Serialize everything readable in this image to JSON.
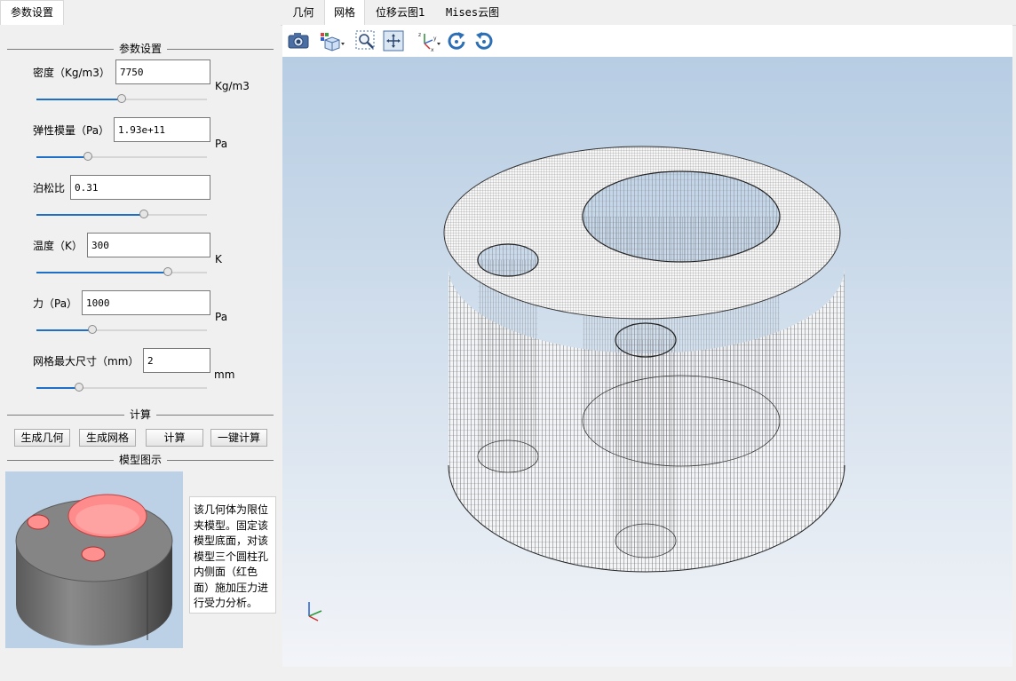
{
  "left_tabs": [
    {
      "label": "参数设置"
    }
  ],
  "right_tabs": [
    {
      "label": "几何"
    },
    {
      "label": "网格"
    },
    {
      "label": "位移云图1"
    },
    {
      "label": "Mises云图"
    }
  ],
  "param_group": {
    "title": "参数设置",
    "params": [
      {
        "label": "密度（Kg/m3）",
        "value": "7750",
        "unit": "Kg/m3",
        "slider": 0.5
      },
      {
        "label": "弹性模量（Pa）",
        "value": "1.93e+11",
        "unit": "Pa",
        "slider": 0.3
      },
      {
        "label": "泊松比",
        "value": "0.31",
        "unit": "",
        "slider": 0.63
      },
      {
        "label": "温度（K）",
        "value": "300",
        "unit": "K",
        "slider": 0.77
      },
      {
        "label": "力（Pa）",
        "value": "1000",
        "unit": "Pa",
        "slider": 0.33
      },
      {
        "label": "网格最大尺寸（mm）",
        "value": "2",
        "unit": "mm",
        "slider": 0.25
      }
    ]
  },
  "compute_group": {
    "title": "计算",
    "buttons": [
      {
        "label": "生成几何"
      },
      {
        "label": "生成网格"
      },
      {
        "label": "计算"
      },
      {
        "label": "一键计算"
      }
    ]
  },
  "model_group": {
    "title": "模型图示",
    "description": "该几何体为限位夹模型。固定该模型底面，对该模型三个圆柱孔内侧面（红色面）施加压力进行受力分析。"
  },
  "toolbar": {
    "icons": [
      "camera-icon",
      "view-cube-icon",
      "zoom-box-icon",
      "fit-all-icon",
      "axes-orient-icon",
      "rotate-cw-icon",
      "rotate-ccw-icon"
    ]
  },
  "colors": {
    "accent": "#1e6fc7",
    "viewport_top": "#b7cde3",
    "viewport_bottom": "#f2f4f8",
    "hole_red": "#ff9090"
  }
}
